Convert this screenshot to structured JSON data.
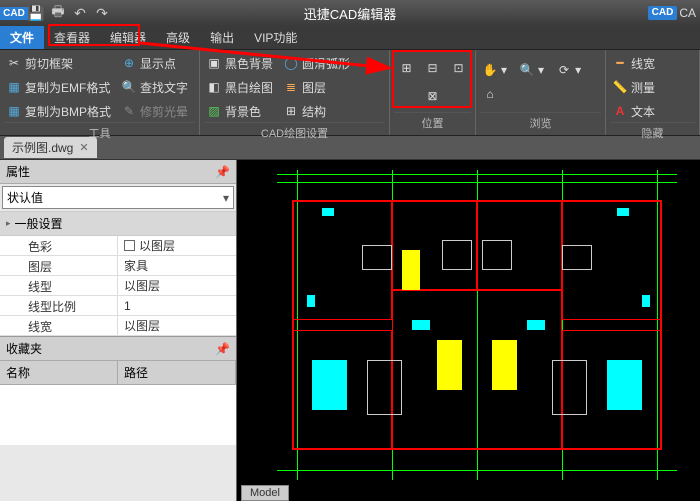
{
  "title": "迅捷CAD编辑器",
  "badge": "CAD",
  "right_label": "CA",
  "menu": {
    "file": "文件",
    "viewer": "查看器",
    "editor": "编辑器",
    "advanced": "高级",
    "output": "输出",
    "vip": "VIP功能"
  },
  "ribbon": {
    "tools": {
      "label": "工具",
      "clip": "剪切框架",
      "showpt": "显示点",
      "copyemf": "复制为EMF格式",
      "findtxt": "查找文字",
      "copybmp": "复制为BMP格式",
      "polish": "修剪光晕"
    },
    "cadset": {
      "label": "CAD绘图设置",
      "blackbg": "黑色背景",
      "smootharc": "圆滑弧形",
      "bwdraw": "黑白绘图",
      "layer": "图层",
      "bgcolor": "背景色",
      "struct": "结构"
    },
    "position": {
      "label": "位置"
    },
    "browse": {
      "label": "浏览"
    },
    "hide": {
      "label": "隐藏",
      "lw": "线宽",
      "measure": "测量",
      "text": "文本"
    }
  },
  "file_tab": {
    "name": "示例图.dwg"
  },
  "props": {
    "panel_title": "属性",
    "combo": "状认值",
    "section": "一般设置",
    "rows": {
      "color": {
        "k": "色彩",
        "v": "以图层"
      },
      "layer": {
        "k": "图层",
        "v": "家具"
      },
      "ltype": {
        "k": "线型",
        "v": "以图层"
      },
      "lscale": {
        "k": "线型比例",
        "v": "1"
      },
      "lw": {
        "k": "线宽",
        "v": "以图层"
      }
    }
  },
  "fav": {
    "title": "收藏夹",
    "col_name": "名称",
    "col_path": "路径"
  },
  "model_tab": "Model"
}
